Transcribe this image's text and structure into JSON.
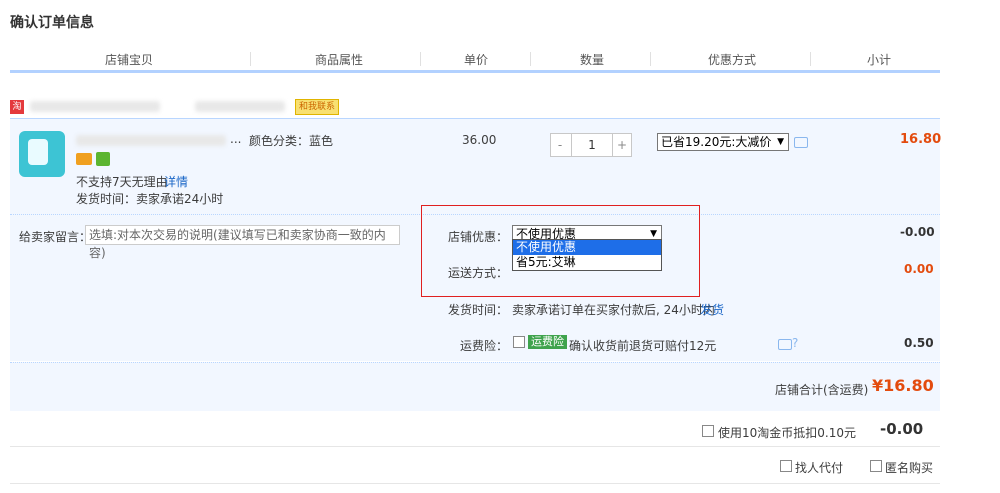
{
  "page_title": "确认订单信息",
  "columns": [
    "店铺宝贝",
    "商品属性",
    "单价",
    "数量",
    "优惠方式",
    "小计"
  ],
  "shop": {
    "contact_label": "和我联系"
  },
  "item": {
    "title_suffix": "...",
    "attr": "颜色分类：蓝色",
    "no_return": "不支持7天无理由",
    "details_link": "详情",
    "ship_promise": "发货时间：卖家承诺24小时",
    "unit_price": "36.00",
    "quantity": "1",
    "qty_minus": "-",
    "qty_plus": "+",
    "discount_select": "已省19.20元:大减价",
    "subtotal": "16.80"
  },
  "options": {
    "note_label": "给卖家留言：",
    "note_placeholder": "选填:对本次交易的说明(建议填写已和卖家协商一致的内容)",
    "shop_discount_label": "店铺优惠：",
    "shop_discount_value": "不使用优惠",
    "shop_discount_options": [
      "不使用优惠",
      "省5元:艾琳"
    ],
    "shop_discount_amount": "-0.00",
    "shipping_label": "运送方式：",
    "shipping_amount": "0.00",
    "ship_time_label": "发货时间：",
    "ship_time_text": "卖家承诺订单在买家付款后, 24小时内",
    "ship_time_link": "发货",
    "insurance_label": "运费险：",
    "insurance_tag": "运费险",
    "insurance_text": "确认收货前退货可赔付12元",
    "insurance_amount": "0.50"
  },
  "total": {
    "label": "店铺合计(含运费)",
    "amount": "¥16.80"
  },
  "footer": {
    "coin_text": "使用10淘金币抵扣0.10元",
    "coin_amount": "-0.00",
    "proxy_pay": "找人代付",
    "anonymous": "匿名购买"
  },
  "colors": {
    "accent_blue": "#1a66c7",
    "price_red": "#e34b0e",
    "panel_bg": "#f2f7ff",
    "highlight": "#e02020"
  }
}
